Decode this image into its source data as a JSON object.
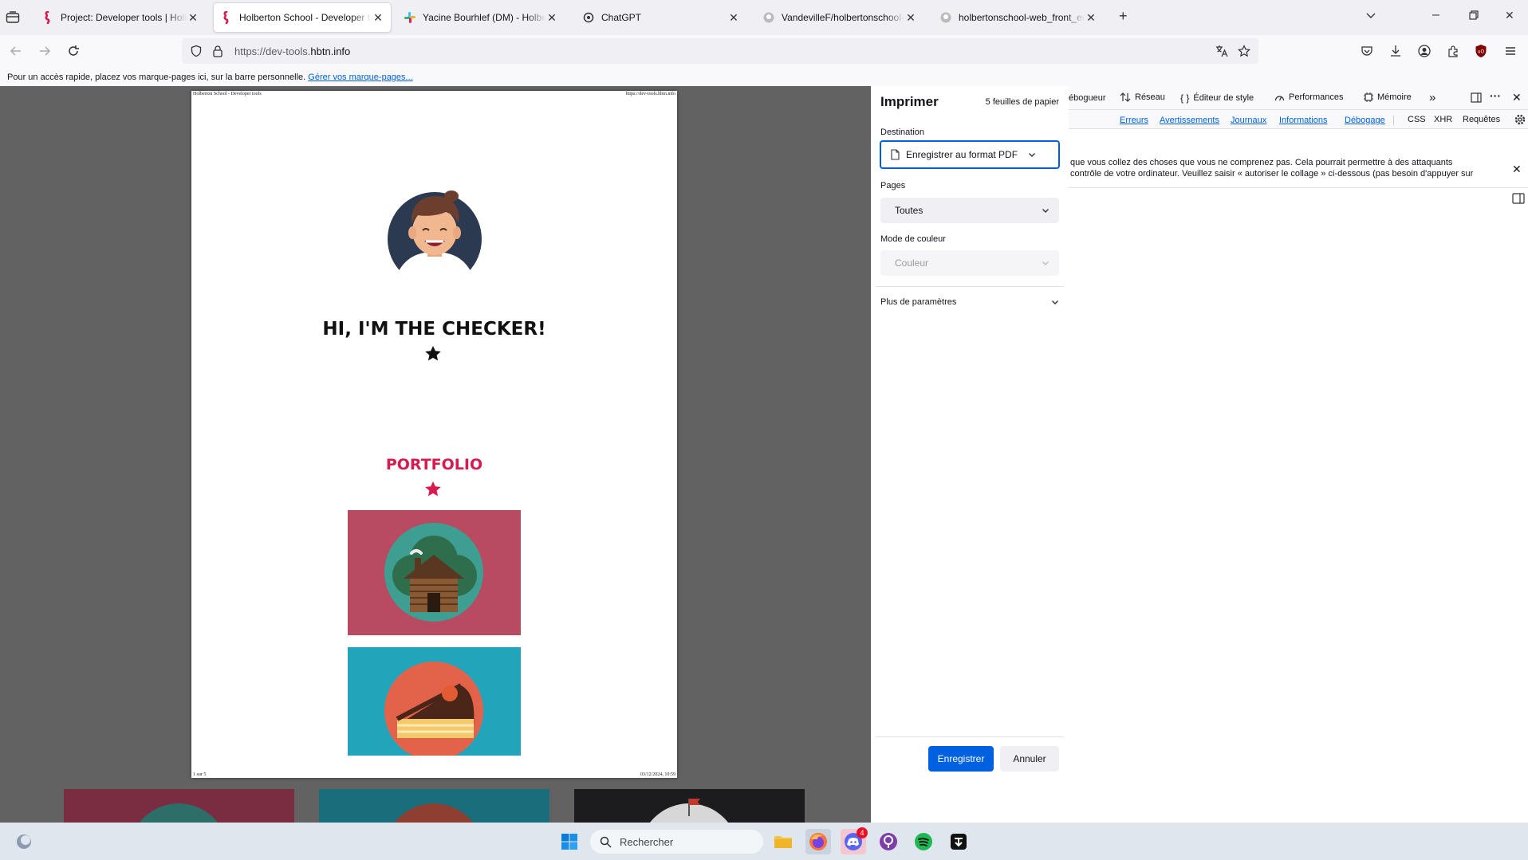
{
  "tabs": [
    {
      "title": "Project: Developer tools | Holberton School",
      "active": false,
      "icon": "holberton-icon"
    },
    {
      "title": "Holberton School - Developer tools",
      "active": true,
      "icon": "holberton-icon"
    },
    {
      "title": "Yacine Bourhlef (DM) - Holberton School",
      "active": false,
      "icon": "slack-icon"
    },
    {
      "title": "ChatGPT",
      "active": false,
      "icon": "chatgpt-icon"
    },
    {
      "title": "VandevilleF/holbertonschool-web_front_end",
      "active": false,
      "icon": "github-icon"
    },
    {
      "title": "holbertonschool-web_front_end",
      "active": false,
      "icon": "github-icon"
    }
  ],
  "urlbar": {
    "prefix": "https://dev-tools.",
    "domain": "hbtn.info"
  },
  "bookmarks_bar": {
    "text": "Pour un accès rapide, placez vos marque-pages ici, sur la barre personnelle. ",
    "link": "Gérer vos marque-pages..."
  },
  "page_preview": {
    "header_left": "Holberton School - Developer tools",
    "header_right": "https://dev-tools.hbtn.info",
    "heading": "HI, I'M THE CHECKER!",
    "portfolio_title": "PORTFOLIO",
    "footer_left": "1 sur 5",
    "footer_right": "03/12/2024, 10:59",
    "colors": {
      "portfolio": "#d81a4f",
      "card1": "#b84a62",
      "card2": "#22a4bb",
      "card3": "#1c1c1e"
    }
  },
  "print_dialog": {
    "title": "Imprimer",
    "sheets": "5 feuilles de papier",
    "destination_label": "Destination",
    "destination_value": "Enregistrer au format PDF",
    "pages_label": "Pages",
    "pages_value": "Toutes",
    "color_label": "Mode de couleur",
    "color_value": "Couleur",
    "more_settings": "Plus de paramètres",
    "save_button": "Enregistrer",
    "cancel_button": "Annuler",
    "accent": "#0061e0"
  },
  "devtools": {
    "tabs": {
      "debugger": "ébogueur",
      "network": "Réseau",
      "style_editor": "Éditeur de style",
      "performance": "Performances",
      "memory": "Mémoire"
    },
    "filters": {
      "errors": "Erreurs",
      "warnings": "Avertissements",
      "logs": "Journaux",
      "info": "Informations",
      "debug": "Débogage",
      "css": "CSS",
      "xhr": "XHR",
      "requests": "Requêtes"
    },
    "warning_line1": "que vous collez des choses que vous ne comprenez pas. Cela pourrait permettre à des attaquants",
    "warning_line2": "contrôle de votre ordinateur. Veuillez saisir « autoriser le collage » ci-dessous (pas besoin d'appuyer sur"
  },
  "taskbar": {
    "search_placeholder": "Rechercher",
    "discord_badge": "4"
  }
}
